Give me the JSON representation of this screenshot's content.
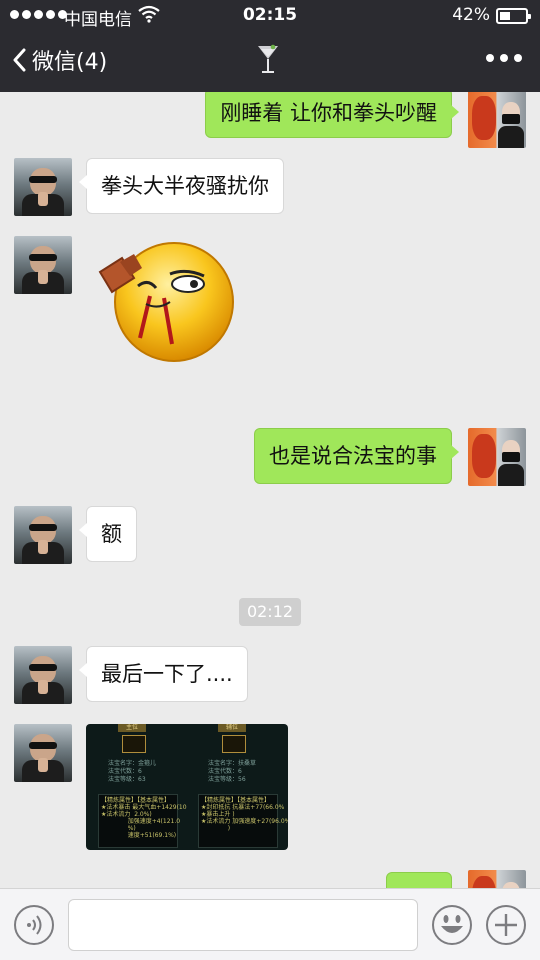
{
  "status_bar": {
    "carrier": "中国电信",
    "time": "02:15",
    "battery_percent": "42%",
    "battery_level": 0.42
  },
  "nav": {
    "back_label": "微信(4)"
  },
  "messages": [
    {
      "side": "right",
      "text": "刚睡着 让你和拳头吵醒"
    },
    {
      "side": "left",
      "text": "拳头大半夜骚扰你"
    },
    {
      "side": "left",
      "type": "sticker"
    },
    {
      "side": "right",
      "text": "也是说合法宝的事"
    },
    {
      "side": "left",
      "text": "额"
    },
    {
      "type": "timestamp",
      "text": "02:12"
    },
    {
      "side": "left",
      "text": "最后一下了...."
    },
    {
      "side": "left",
      "type": "image"
    },
    {
      "side": "right",
      "text": ""
    }
  ],
  "image_message": {
    "left_tab": "主位",
    "right_tab": "辅位",
    "left_info": "法宝名字：金箍儿\n法宝代数：6\n法宝等级：63",
    "right_info": "法宝名字：扶桑草\n法宝代数：6\n法宝等级：56",
    "left_stats": "【精炼属性】【基本属性】\n★法术暴击 最大气血+1429(10\n★法术流力  2.0%)\n              加强速度+4(121.0\n              %)\n              速度+51(69.1%)",
    "right_stats": "【精炼属性】【基本属性】\n★封印抵抗 抗暴法+77(66.0%\n★暴击上升 )\n★法术流力 加强速度+27(96.0%\n              )"
  },
  "colors": {
    "bubble_right": "#a0e75a",
    "bubble_left": "#ffffff",
    "topbar": "#2b2b30",
    "chat_bg": "#ebebeb"
  }
}
